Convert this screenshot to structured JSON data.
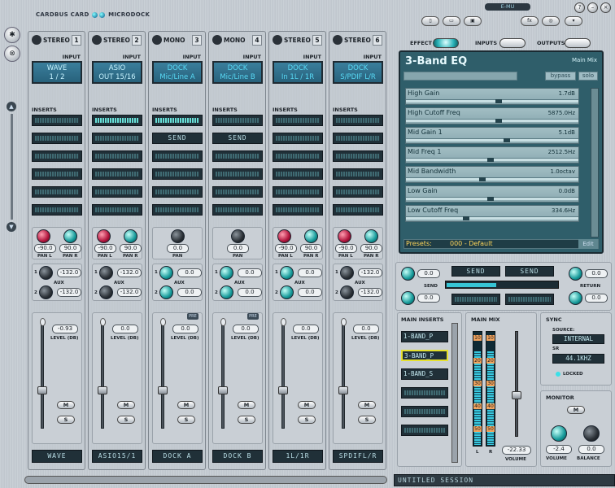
{
  "app": {
    "brand_left": "CARDBUS CARD",
    "brand_right": "MICRODOCK",
    "emu_logo": "E-MU",
    "session_name": "UNTITLED SESSION",
    "top_buttons": [
      "new-session",
      "open-session",
      "save-session",
      "fx",
      "zoom",
      "menu"
    ],
    "help_label": "?",
    "minimize_label": "–",
    "close_label": "×"
  },
  "strips": [
    {
      "type": "STEREO",
      "num": "1",
      "input": "WAVE\n1 / 2",
      "input_line1": "WAVE",
      "input_line2": "1 / 2",
      "dock": false,
      "insert1": "meter-off",
      "send": false,
      "pan_l": "-90.0",
      "pan_r": "90.0",
      "stereo_pan": true,
      "aux1": "-132.0",
      "aux2": "-132.0",
      "level": "-0.93",
      "pre": false,
      "name": "WAVE"
    },
    {
      "type": "STEREO",
      "num": "2",
      "input_line1": "ASIO",
      "input_line2": "OUT 15/16",
      "dock": false,
      "insert1": "meter-on",
      "send": false,
      "pan_l": "-90.0",
      "pan_r": "90.0",
      "stereo_pan": true,
      "aux1": "-132.0",
      "aux2": "-132.0",
      "level": "0.0",
      "pre": false,
      "name": "ASIO15/1"
    },
    {
      "type": "MONO",
      "num": "3",
      "input_line1": "DOCK",
      "input_line2": "Mic/Line A",
      "dock": true,
      "insert1": "meter-on",
      "send": true,
      "pan": "0.0",
      "stereo_pan": false,
      "aux1": "0.0",
      "aux2": "0.0",
      "level": "0.0",
      "pre": true,
      "name": "DOCK A"
    },
    {
      "type": "MONO",
      "num": "4",
      "input_line1": "DOCK",
      "input_line2": "Mic/Line B",
      "dock": true,
      "insert1": "meter-off",
      "send": true,
      "pan": "0.0",
      "stereo_pan": false,
      "aux1": "0.0",
      "aux2": "0.0",
      "level": "0.0",
      "pre": true,
      "name": "DOCK B"
    },
    {
      "type": "STEREO",
      "num": "5",
      "input_line1": "DOCK",
      "input_line2": "In 1L / 1R",
      "dock": true,
      "insert1": "meter-off",
      "send": false,
      "pan_l": "-90.0",
      "pan_r": "90.0",
      "stereo_pan": true,
      "aux1": "0.0",
      "aux2": "0.0",
      "level": "0.0",
      "pre": false,
      "name": "1L/1R"
    },
    {
      "type": "STEREO",
      "num": "6",
      "input_line1": "DOCK",
      "input_line2": "S/PDIF L/R",
      "dock": true,
      "insert1": "meter-off",
      "send": false,
      "pan_l": "-90.0",
      "pan_r": "90.0",
      "stereo_pan": true,
      "aux1": "-132.0",
      "aux2": "-132.0",
      "level": "0.0",
      "pre": false,
      "name": "SPDIFL/R"
    }
  ],
  "labels": {
    "input": "INPUT",
    "inserts": "INSERTS",
    "send": "SEND",
    "pan_l": "PAN L",
    "pan_r": "PAN R",
    "pan": "PAN",
    "aux": "AUX",
    "level": "LEVEL (DB)",
    "mute": "M",
    "solo": "S",
    "pre": "PRE"
  },
  "tabs": {
    "effect": "EFFECT",
    "inputs": "INPUTS",
    "outputs": "OUTPUTS"
  },
  "effect": {
    "title": "3-Band EQ",
    "mix_label": "Main Mix",
    "btn_bypass": "bypass",
    "btn_solo": "solo",
    "params": [
      {
        "name": "High Gain",
        "value": "1.7dB",
        "pos": 0.55
      },
      {
        "name": "High Cutoff Freq",
        "value": "5875.0Hz",
        "pos": 0.55
      },
      {
        "name": "Mid Gain 1",
        "value": "5.1dB",
        "pos": 0.6
      },
      {
        "name": "Mid Freq 1",
        "value": "2512.5Hz",
        "pos": 0.5
      },
      {
        "name": "Mid Bandwidth",
        "value": "1.0octav",
        "pos": 0.45
      },
      {
        "name": "Low Gain",
        "value": "0.0dB",
        "pos": 0.5
      },
      {
        "name": "Low Cutoff Freq",
        "value": "334.6Hz",
        "pos": 0.35
      }
    ],
    "presets_label": "Presets:",
    "preset_value": "000 - Default",
    "edit_label": "Edit"
  },
  "sends": {
    "send_btn1": "SEND",
    "send_btn2": "SEND",
    "aux1": "0.0",
    "aux2": "0.0",
    "return1": "0.0",
    "return2": "0.0",
    "send_label": "SEND",
    "return_label": "RETURN",
    "send_level": 0.45
  },
  "main_inserts": {
    "title": "MAIN INSERTS",
    "items": [
      "1-BAND_P",
      "3-BAND_P",
      "1-BAND_S",
      "",
      "",
      ""
    ],
    "selected_index": 1
  },
  "main_mix": {
    "title": "MAIN MIX",
    "ticks": [
      "10",
      "20",
      "30",
      "40",
      "50"
    ],
    "left_label": "L",
    "right_label": "R",
    "volume": "-22.33",
    "volume_label": "VOLUME"
  },
  "sync": {
    "title": "SYNC",
    "source_label": "SOURCE:",
    "source_value": "INTERNAL",
    "sr_label": "SR",
    "sr_value": "44.1KHZ",
    "locked_label": "LOCKED"
  },
  "monitor": {
    "title": "MONITOR",
    "mute": "M",
    "volume": "-2.4",
    "balance": "0.0",
    "volume_label": "VOLUME",
    "balance_label": "BALANCE"
  }
}
